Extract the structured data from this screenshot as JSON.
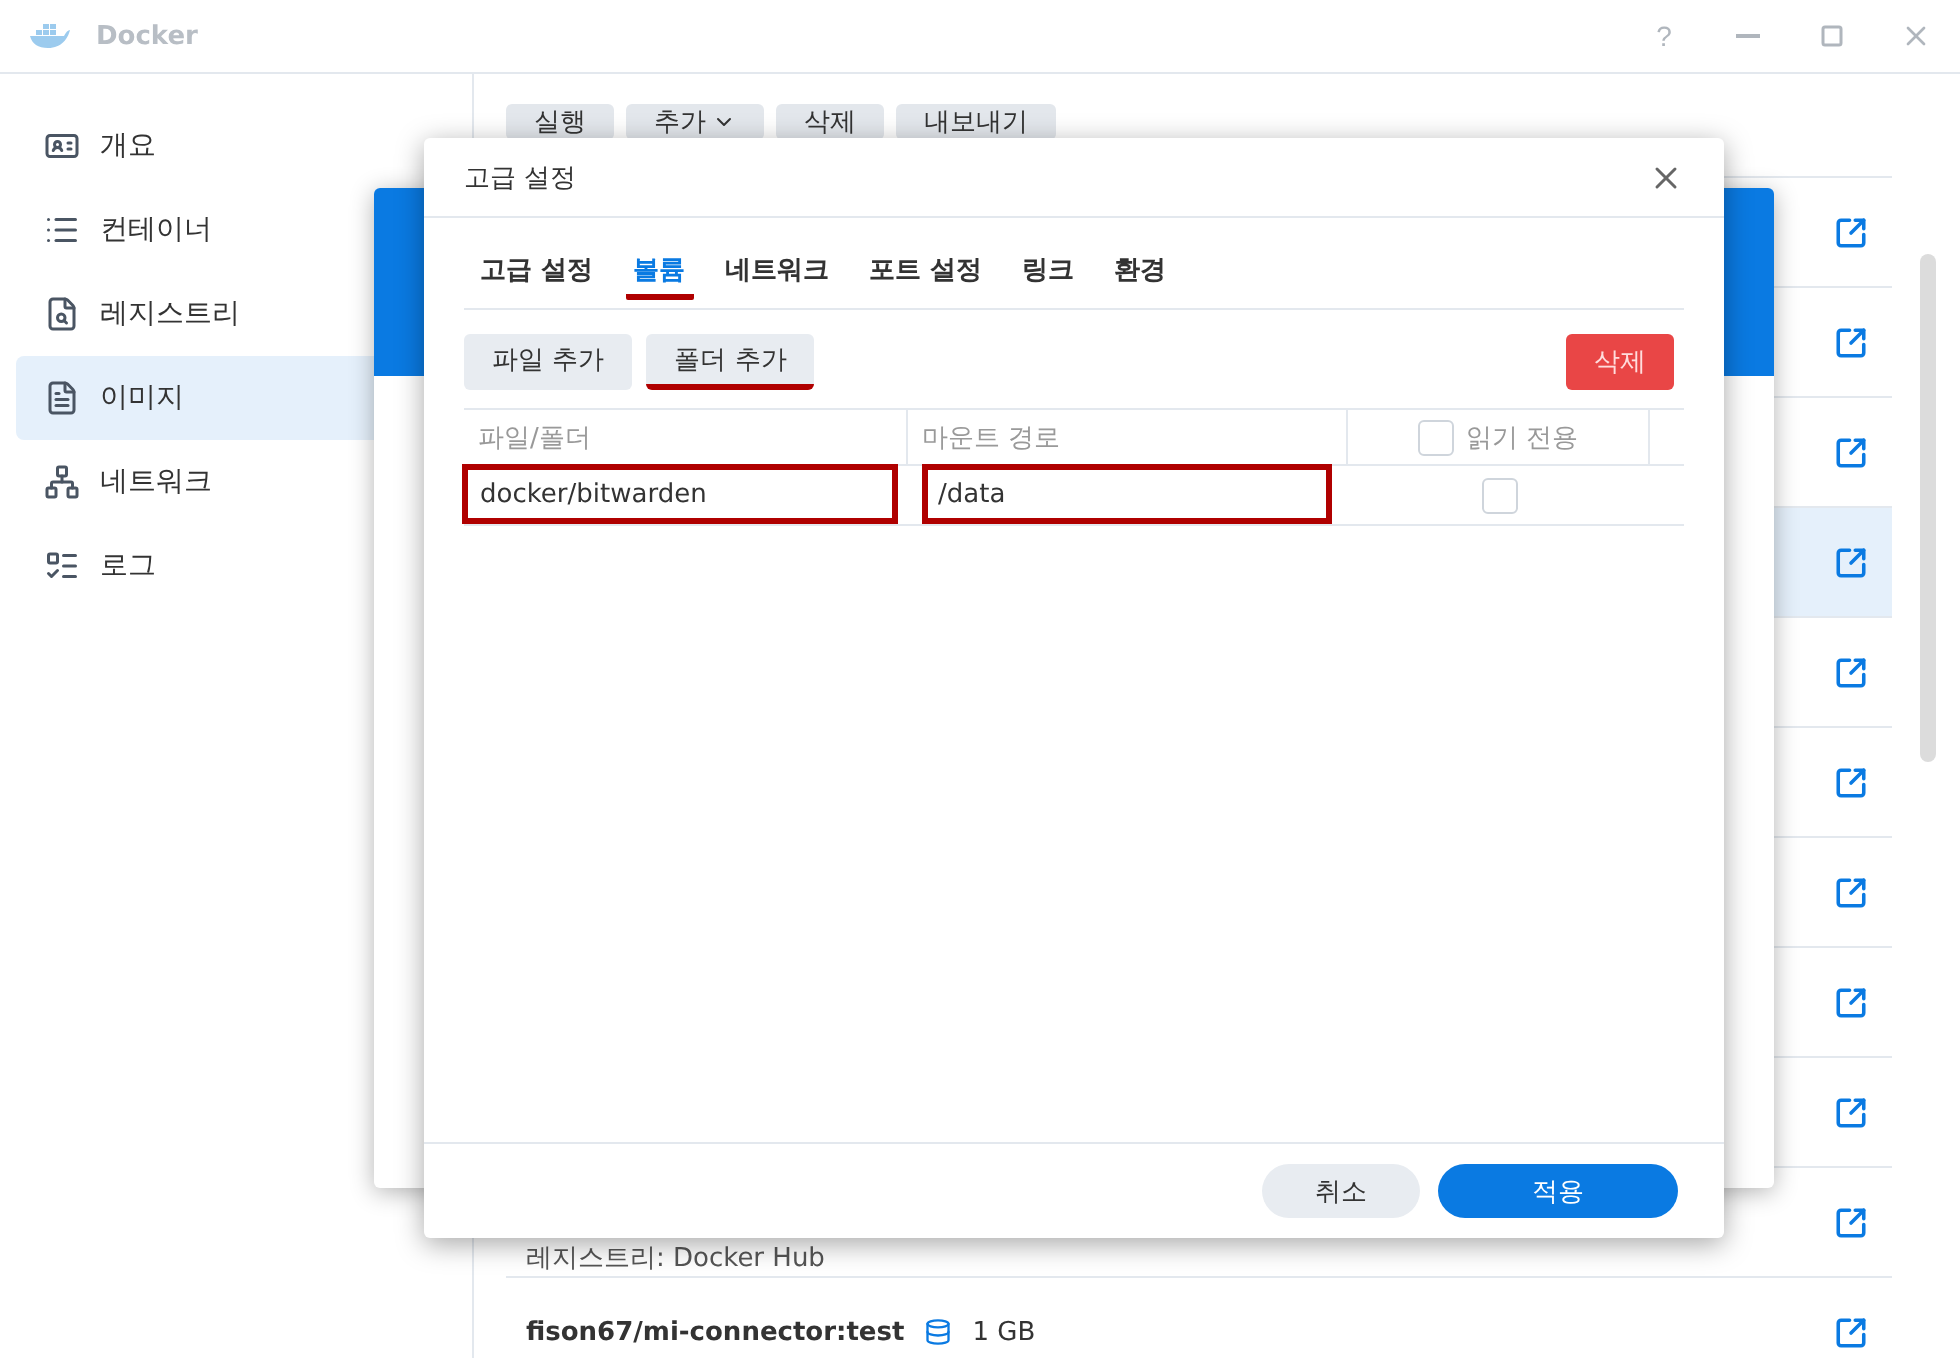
{
  "title_bar": {
    "title": "Docker",
    "help": "?"
  },
  "sidebar": {
    "items": [
      {
        "label": "개요",
        "selected": false
      },
      {
        "label": "컨테이너",
        "selected": false
      },
      {
        "label": "레지스트리",
        "selected": false
      },
      {
        "label": "이미지",
        "selected": true
      },
      {
        "label": "네트워크",
        "selected": false
      },
      {
        "label": "로그",
        "selected": false
      }
    ]
  },
  "toolbar": {
    "buttons": [
      {
        "label": "실행",
        "dropdown": false
      },
      {
        "label": "추가",
        "dropdown": true
      },
      {
        "label": "삭제",
        "dropdown": false
      },
      {
        "label": "내보내기",
        "dropdown": false
      }
    ]
  },
  "image_list": {
    "rows": [
      {
        "selected": false
      },
      {
        "selected": false
      },
      {
        "selected": false
      },
      {
        "selected": true
      },
      {
        "selected": false
      },
      {
        "selected": false
      },
      {
        "selected": false
      },
      {
        "selected": false
      },
      {
        "selected": false
      },
      {
        "selected": false,
        "detail": "레지스트리: Docker Hub"
      },
      {
        "selected": false,
        "name": "fison67/mi-connector:test",
        "size": "1 GB"
      }
    ]
  },
  "dialog": {
    "title": "고급 설정",
    "tabs": [
      {
        "label": "고급 설정",
        "selected": false,
        "marked": false
      },
      {
        "label": "볼륨",
        "selected": true,
        "marked": true
      },
      {
        "label": "네트워크",
        "selected": false,
        "marked": false
      },
      {
        "label": "포트 설정",
        "selected": false,
        "marked": false
      },
      {
        "label": "링크",
        "selected": false,
        "marked": false
      },
      {
        "label": "환경",
        "selected": false,
        "marked": false
      }
    ],
    "actions": [
      {
        "label": "파일 추가",
        "marked": false
      },
      {
        "label": "폴더 추가",
        "marked": true
      }
    ],
    "delete": "삭제",
    "table": {
      "columns": [
        "파일/폴더",
        "마운트 경로",
        "읽기 전용"
      ],
      "read_only_all": {
        "checked": false
      },
      "rows": [
        {
          "path": "docker/bitwarden",
          "mount": "/data",
          "read_only": false,
          "marked": true
        }
      ]
    },
    "buttons": {
      "cancel": "취소",
      "apply": "적용"
    }
  }
}
